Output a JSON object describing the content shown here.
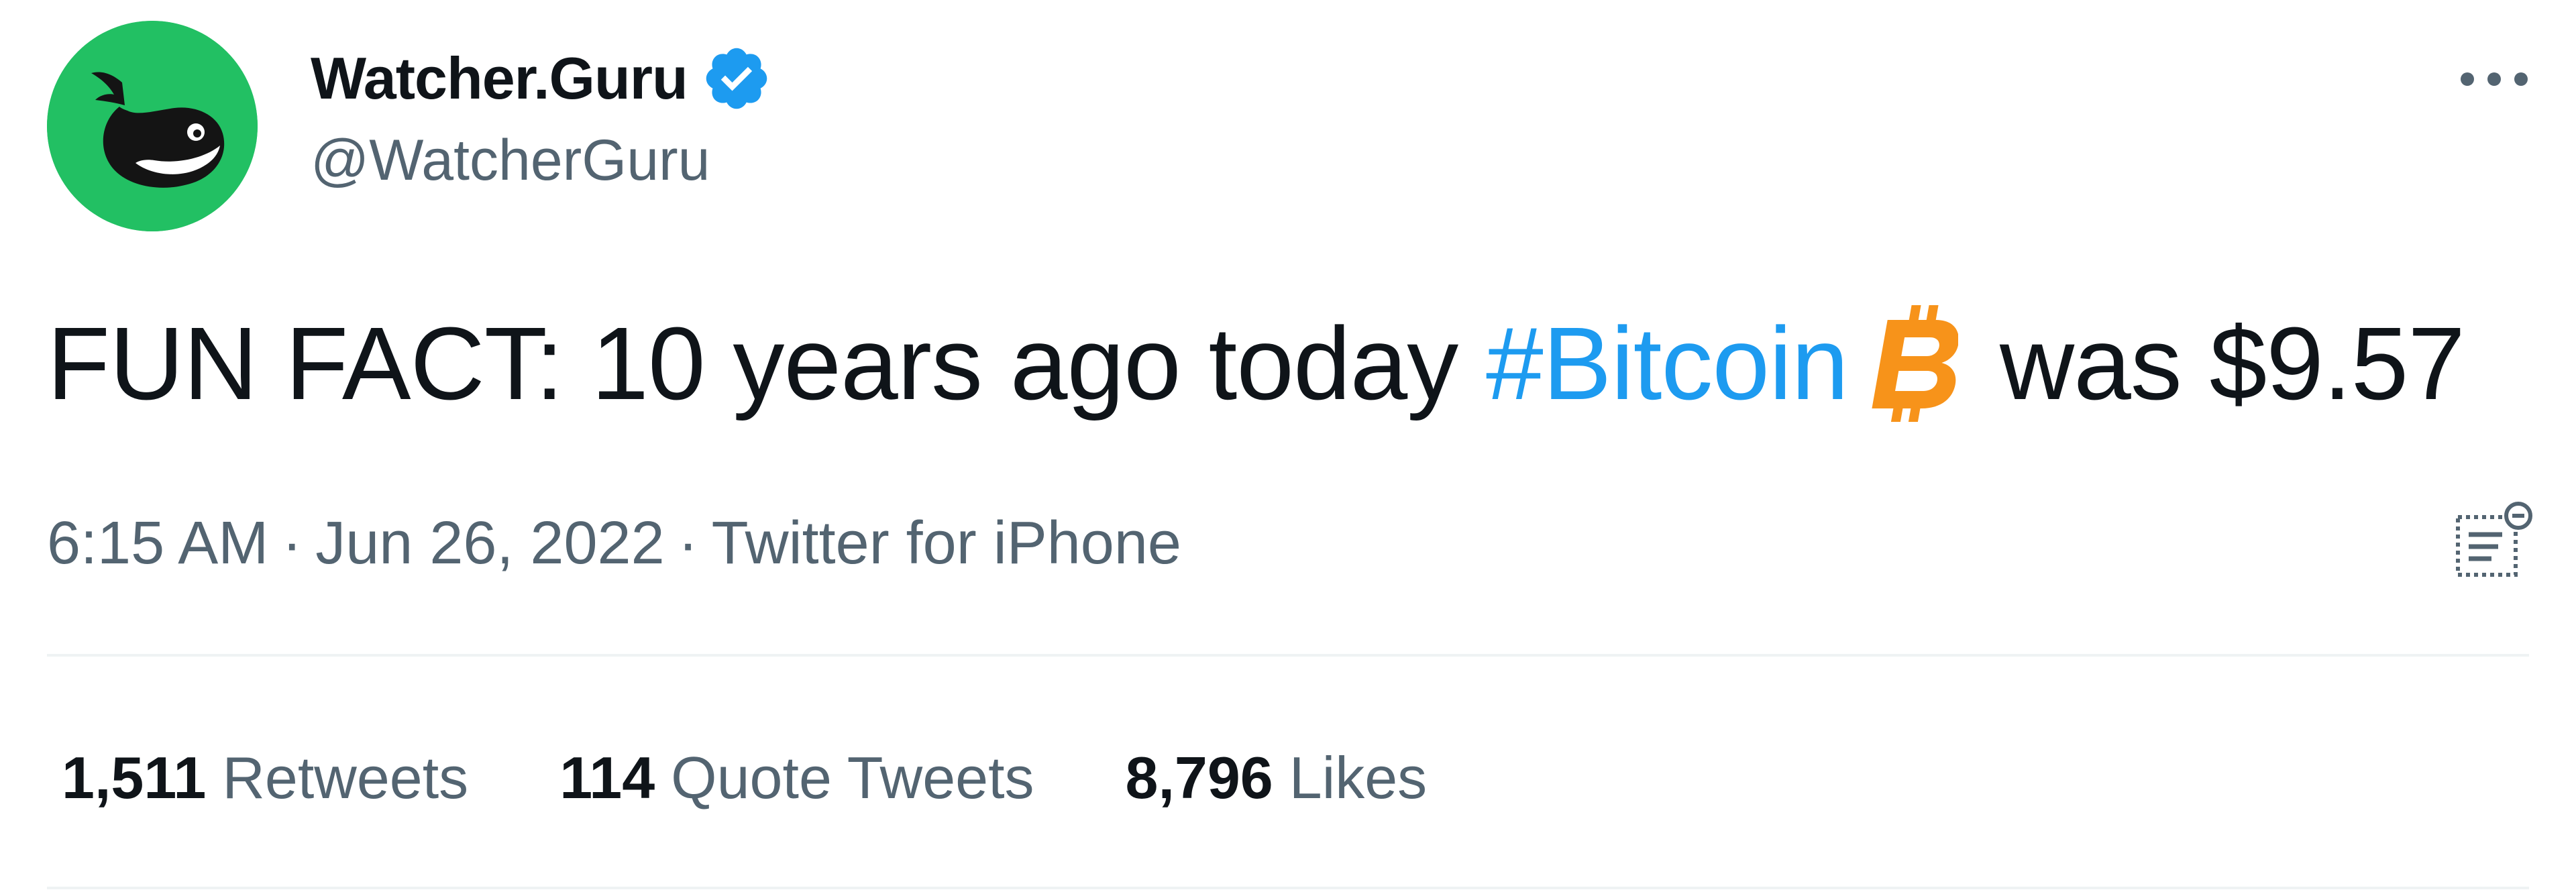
{
  "author": {
    "display_name": "Watcher.Guru",
    "handle": "@WatcherGuru",
    "verified": true,
    "avatar_icon": "whale-icon",
    "avatar_bg_color": "#22c063"
  },
  "tweet": {
    "text_before": "FUN FACT: 10 years ago today",
    "hashtag": "#Bitcoin",
    "emoji_icon": "bitcoin-icon",
    "text_after": "was $9.57",
    "hashtag_color": "#1d9bf0"
  },
  "meta": {
    "time": "6:15 AM",
    "separator": "·",
    "date": "Jun 26, 2022",
    "source": "Twitter for iPhone"
  },
  "stats": [
    {
      "count": "1,511",
      "label": "Retweets"
    },
    {
      "count": "114",
      "label": "Quote Tweets"
    },
    {
      "count": "8,796",
      "label": "Likes"
    }
  ],
  "colors": {
    "text_primary": "#0f1419",
    "text_secondary": "#536471",
    "divider": "#eff3f4",
    "verified_badge": "#1d9bf0",
    "bitcoin_orange": "#f7931a"
  }
}
